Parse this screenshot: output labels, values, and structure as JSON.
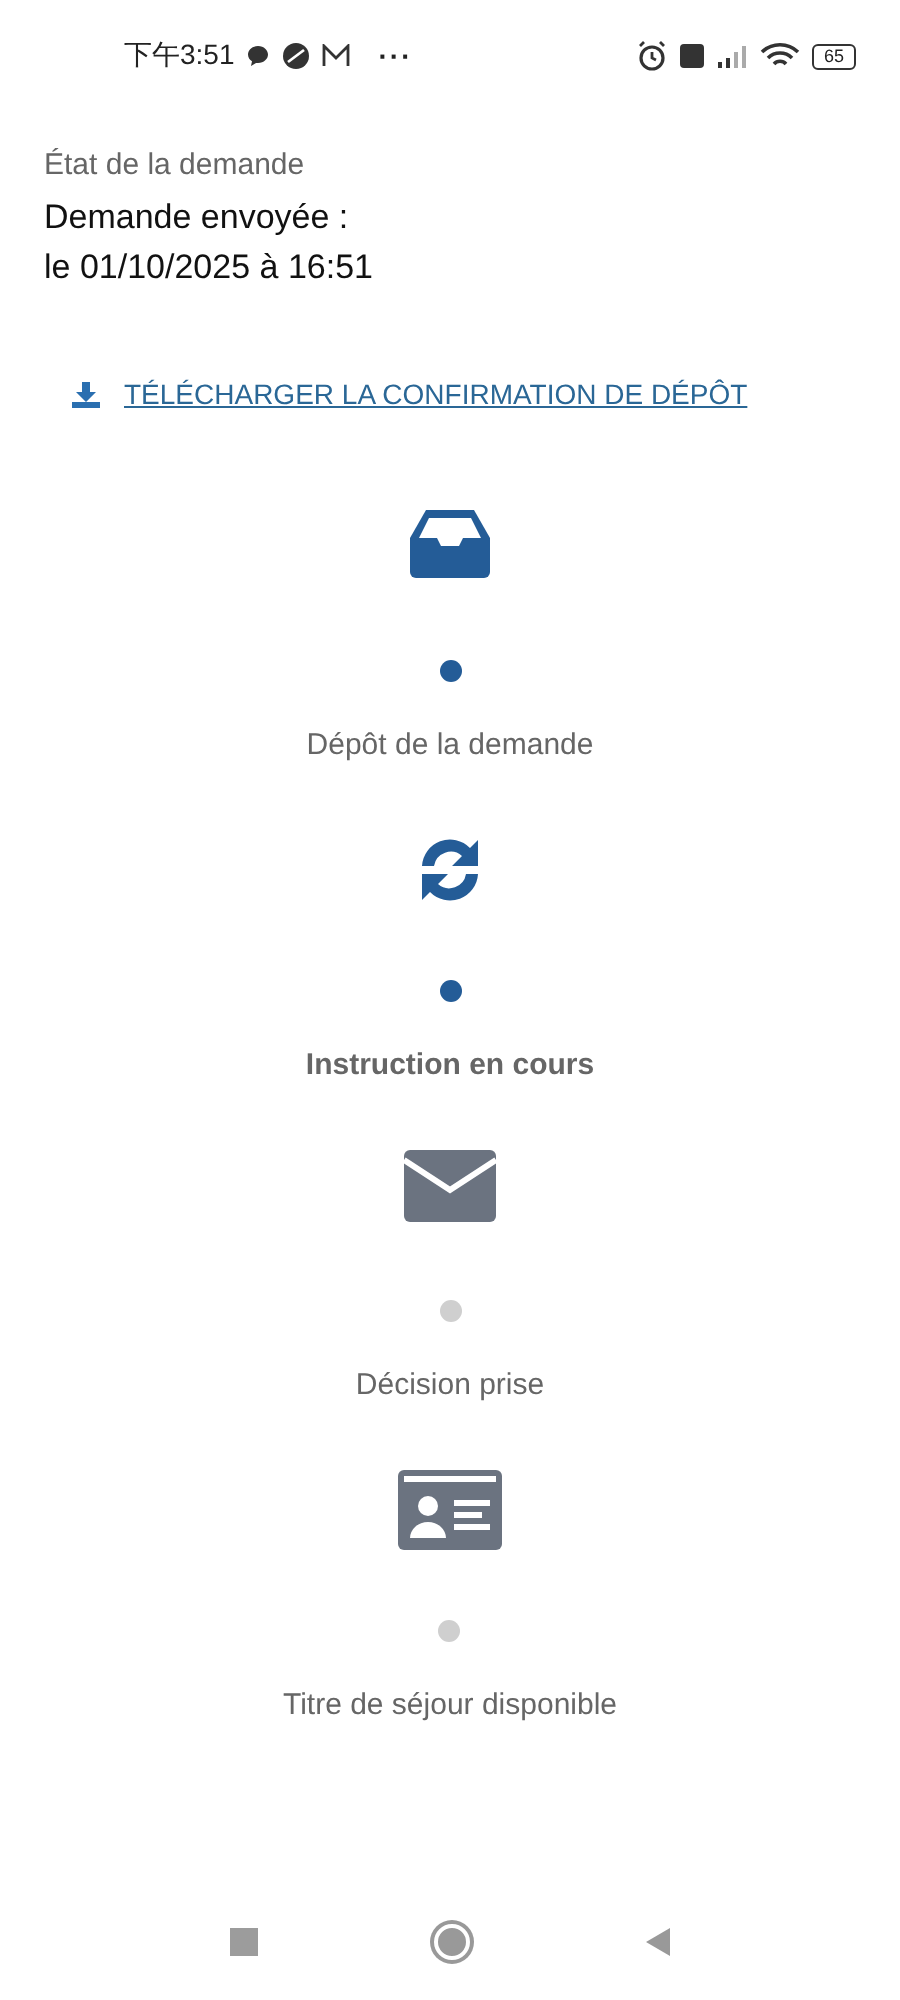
{
  "status_bar": {
    "time": "下午3:51",
    "more": "···",
    "battery": "65"
  },
  "request": {
    "label": "État de la demande",
    "status": "Demande envoyée :",
    "date": "le 01/10/2025 à 16:51"
  },
  "download_link": "TÉLÉCHARGER LA CONFIRMATION DE DÉPÔT",
  "steps": [
    {
      "kind": "inbox",
      "label": "Dépôt de la demande",
      "reached": true,
      "current": false
    },
    {
      "kind": "sync",
      "label": "Instruction en cours",
      "reached": true,
      "current": true
    },
    {
      "kind": "mail",
      "label": "Décision prise",
      "reached": false,
      "current": false
    },
    {
      "kind": "card",
      "label": "Titre de séjour disponible",
      "reached": false,
      "current": false
    }
  ]
}
